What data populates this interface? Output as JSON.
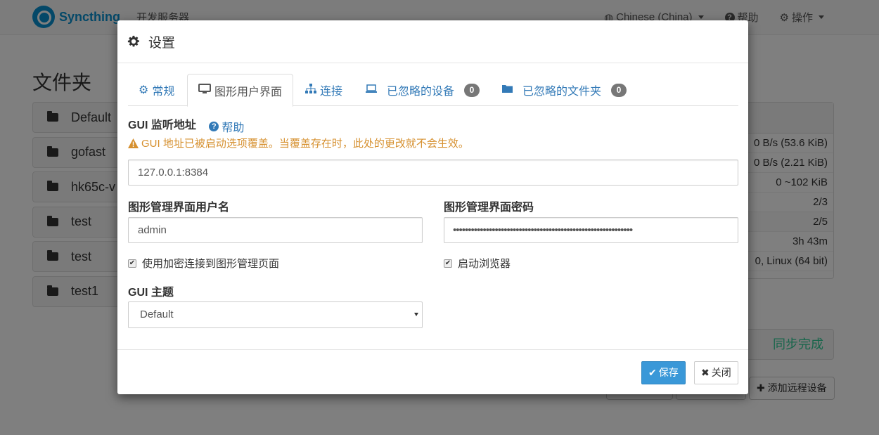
{
  "navbar": {
    "brand": "Syncthing",
    "device_name": "开发服务器",
    "language": "Chinese (China)",
    "help": "帮助",
    "actions": "操作"
  },
  "background": {
    "folders_title": "文件夹",
    "folders": [
      "Default",
      "gofast",
      "hk65c-v",
      "test",
      "test",
      "test1"
    ],
    "device_rows": [
      "0 B/s (53.6 KiB)",
      "0 B/s (2.21 KiB)",
      "0   ~102 KiB",
      "2/3",
      "2/5",
      "3h 43m",
      "0, Linux (64 bit)"
    ],
    "sync_status": "同步完成",
    "add_remote_device": "添加远程设备"
  },
  "modal": {
    "title": "设置",
    "tabs": [
      {
        "label": "常规",
        "icon": "gear-icon"
      },
      {
        "label": "图形用户界面",
        "icon": "desktop-icon",
        "active": true
      },
      {
        "label": "连接",
        "icon": "sitemap-icon"
      },
      {
        "label": "已忽略的设备",
        "icon": "laptop-icon",
        "badge": "0"
      },
      {
        "label": "已忽略的文件夹",
        "icon": "folder-icon",
        "badge": "0"
      }
    ],
    "gui_listen_label": "GUI 监听地址",
    "help_link": "帮助",
    "override_warning": "GUI 地址已被启动选项覆盖。当覆盖存在时，此处的更改就不会生效。",
    "gui_address": "127.0.0.1:8384",
    "username_label": "图形管理界面用户名",
    "username": "admin",
    "password_label": "图形管理界面密码",
    "password_masked": "••••••••••••••••••••••••••••••••••••••••••••••••••••••••••••",
    "use_tls_label": "使用加密连接到图形管理页面",
    "use_tls_checked": true,
    "start_browser_label": "启动浏览器",
    "start_browser_checked": true,
    "theme_label": "GUI 主题",
    "theme_value": "Default",
    "save_button": "保存",
    "close_button": "关闭"
  },
  "colors": {
    "link": "#337ab7",
    "warning": "#d6902f",
    "primary": "#3a98d8",
    "success": "#33cc99",
    "brand": "#0891d1"
  }
}
